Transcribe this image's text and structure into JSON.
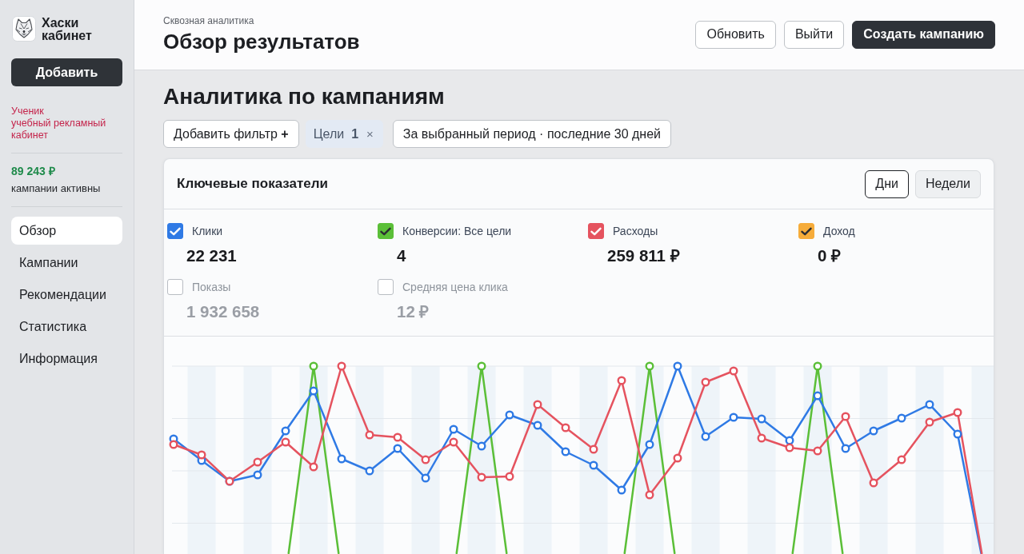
{
  "sidebar": {
    "app_name": "Хаски кабинет",
    "add_button": "Добавить",
    "account": {
      "role": "Ученик",
      "name": "учебный рекламный кабинет"
    },
    "balance": {
      "amount": "89 243 ₽",
      "status": "кампании активны"
    },
    "nav": [
      {
        "label": "Обзор",
        "selected": true
      },
      {
        "label": "Кампании",
        "selected": false
      },
      {
        "label": "Рекомендации",
        "selected": false
      },
      {
        "label": "Статистика",
        "selected": false
      },
      {
        "label": "Информация",
        "selected": false
      }
    ]
  },
  "header": {
    "breadcrumb": "Сквозная аналитика",
    "title": "Обзор результатов",
    "buttons": [
      {
        "label": "Обновить",
        "kind": "secondary"
      },
      {
        "label": "Выйти",
        "kind": "secondary"
      },
      {
        "label": "Создать кампанию",
        "kind": "primary"
      }
    ]
  },
  "content": {
    "title": "Аналитика по кампаниям",
    "filters": {
      "add_filter": "Добавить фильтр **+**",
      "chip": {
        "label": "Цели",
        "count": "1",
        "remove": "×"
      },
      "period": "За выбранный период · последние 30 дней"
    }
  },
  "card": {
    "title": "Ключевые показатели",
    "granularity": [
      {
        "label": "Дни",
        "selected": true
      },
      {
        "label": "Недели",
        "selected": false
      }
    ],
    "metrics": [
      {
        "label": "Клики",
        "value": "22 231",
        "checked": true,
        "color": "#2f7ae5"
      },
      {
        "label": "Конверсии: Все цели",
        "value": "4",
        "checked": true,
        "color": "#5bbf38"
      },
      {
        "label": "Расходы",
        "value": "259 811 ₽",
        "checked": true,
        "color": "#e5535f"
      },
      {
        "label": "Доход",
        "value": "0 ₽",
        "checked": true,
        "color": "#f6ac3a"
      },
      {
        "label": "Показы",
        "value": "1 932 658",
        "checked": false
      },
      {
        "label": "Средняя цена клика",
        "value": "12 ₽",
        "checked": false
      }
    ]
  }
}
